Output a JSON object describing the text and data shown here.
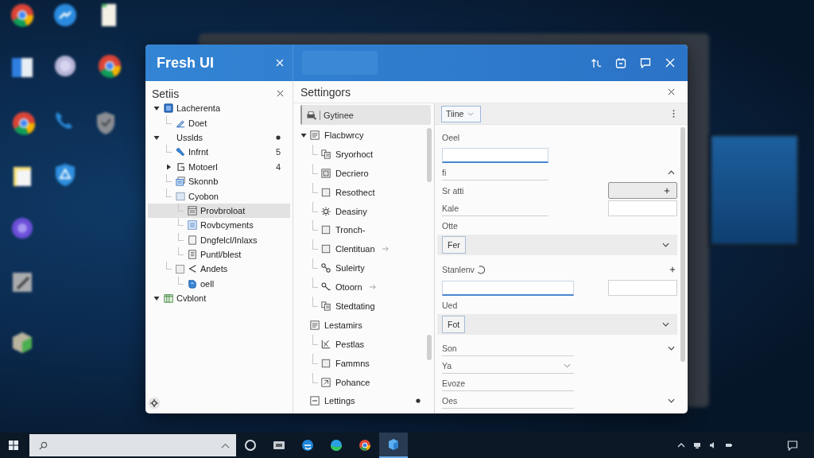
{
  "window": {
    "title": "Fresh UI"
  },
  "sidebar": {
    "title": "Setiis",
    "items": [
      {
        "label": "Lacherenta",
        "selected": false,
        "expanded": true,
        "children": [
          {
            "label": "Doet",
            "selected": false
          }
        ]
      },
      {
        "label": "Usslds",
        "selected": false,
        "expanded": true,
        "dot": true,
        "children": [
          {
            "label": "Infrnt",
            "selected": false,
            "count": "5"
          },
          {
            "label": "Motoerl",
            "selected": false,
            "expanded": false,
            "count": "4"
          },
          {
            "label": "Skonnb",
            "selected": false
          },
          {
            "label": "Cyobon",
            "selected": false,
            "children": [
              {
                "label": "Provbroloat",
                "selected": true
              },
              {
                "label": "Rovbcyments",
                "selected": false
              },
              {
                "label": "Dngfelcl/Inlaxs",
                "selected": false
              },
              {
                "label": "Puntl/blest",
                "selected": false
              }
            ]
          },
          {
            "label": "Andets",
            "selected": false,
            "checked": false,
            "children": [
              {
                "label": "oell",
                "selected": false
              }
            ]
          }
        ]
      },
      {
        "label": "Cvblont",
        "selected": false,
        "expanded": true
      }
    ]
  },
  "middle": {
    "title": "Settingors",
    "options_button": {
      "label": "Gytinee"
    },
    "items": [
      {
        "label": "Flacbwrcy",
        "selected": false,
        "expanded": true,
        "children": [
          {
            "label": "Sryorhoct",
            "selected": false
          },
          {
            "label": "Decriero",
            "selected": false
          },
          {
            "label": "Resothect",
            "selected": false
          },
          {
            "label": "Deasiny",
            "selected": false
          },
          {
            "label": "Tronch-",
            "selected": false
          },
          {
            "label": "Clentituan",
            "selected": false,
            "submenu": true
          },
          {
            "label": "Suleirty",
            "selected": false
          },
          {
            "label": "Otoorn",
            "selected": false,
            "submenu": true
          },
          {
            "label": "Stedtating",
            "selected": false
          }
        ]
      },
      {
        "label": "Lestamirs",
        "selected": false,
        "children": [
          {
            "label": "Pestlas",
            "selected": false
          },
          {
            "label": "Fammns",
            "selected": false
          },
          {
            "label": "Pohance",
            "selected": false
          }
        ]
      },
      {
        "label": "Lettings",
        "selected": false,
        "dot": true
      }
    ]
  },
  "detail": {
    "toolbar": {
      "dropdown": "Tiine"
    },
    "form": [
      {
        "kind": "label",
        "text": "Oeel"
      },
      {
        "kind": "input",
        "focused": true
      },
      {
        "kind": "field",
        "value": "fi",
        "side": {
          "kind": "toggle",
          "expanded": true
        }
      },
      {
        "kind": "text",
        "text": "Sr atti",
        "side": {
          "kind": "add-box"
        }
      },
      {
        "kind": "field",
        "value": "Kale",
        "side": {
          "kind": "input"
        }
      },
      {
        "kind": "label",
        "text": "Otte"
      },
      {
        "kind": "band",
        "button": "Fer",
        "side": {
          "kind": "toggle",
          "expanded": false
        }
      },
      {
        "kind": "loading",
        "text": "Stanlenv",
        "side": {
          "kind": "add"
        }
      },
      {
        "kind": "input",
        "focused": true,
        "side": {
          "kind": "input"
        }
      },
      {
        "kind": "label",
        "text": "Ued"
      },
      {
        "kind": "band",
        "button": "Fot",
        "side": {
          "kind": "toggle",
          "expanded": false
        }
      },
      {
        "kind": "field",
        "value": "Son",
        "side": {
          "kind": "toggle",
          "expanded": false
        }
      },
      {
        "kind": "select",
        "value": "Ya"
      },
      {
        "kind": "field",
        "value": "Evoze"
      },
      {
        "kind": "field",
        "value": "Oes",
        "side": {
          "kind": "toggle",
          "expanded": false
        }
      }
    ]
  },
  "taskbar": {
    "apps": [
      {
        "selected": false
      },
      {
        "selected": false
      },
      {
        "selected": false
      },
      {
        "selected": false
      },
      {
        "selected": false
      },
      {
        "selected": true
      }
    ]
  }
}
